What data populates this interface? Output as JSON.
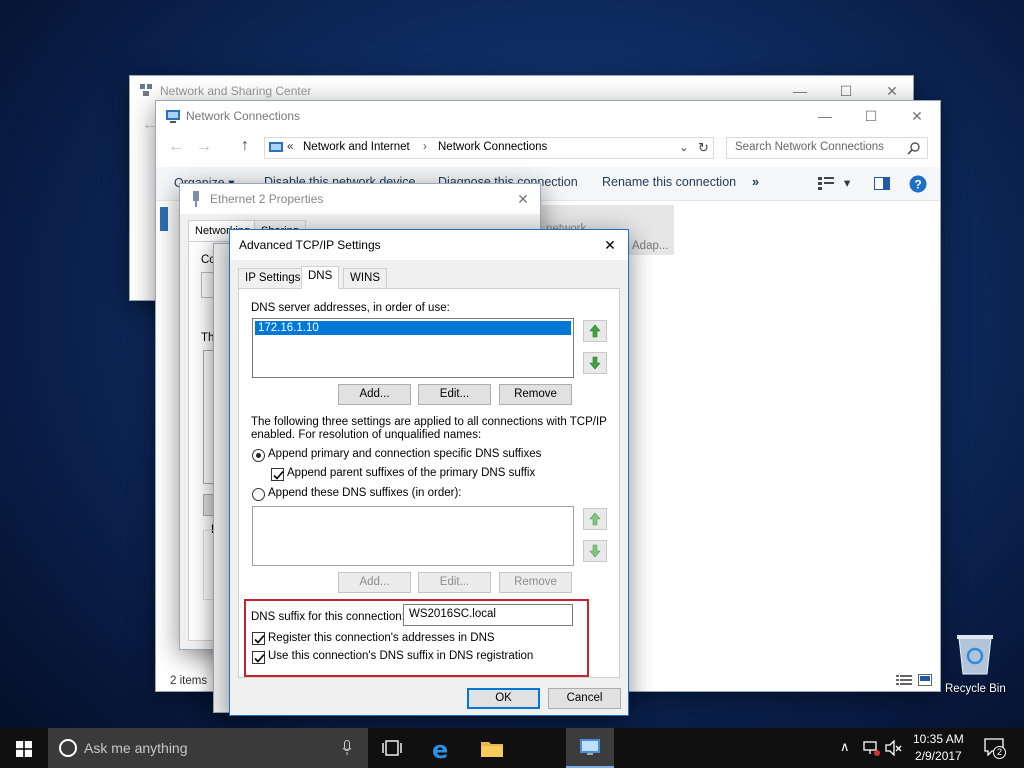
{
  "network_sharing_center": {
    "title": "Network and Sharing Center"
  },
  "network_connections": {
    "title": "Network Connections",
    "breadcrumb": [
      "«",
      "Network and Internet",
      "Network Connections"
    ],
    "search_placeholder": "Search Network Connections",
    "commands": {
      "organize": "Organize ▾",
      "disable": "Disable this network device",
      "diagnose": "Diagnose this connection",
      "rename": "Rename this connection",
      "more": "»"
    },
    "item_partial_1": "network",
    "item_partial_2": "Adap...",
    "status": "2 items"
  },
  "ethernet_properties": {
    "title": "Ethernet 2 Properties",
    "tabs": [
      "Networking",
      "Sharing"
    ],
    "label_partial_1": "Co",
    "label_partial_2": "Th",
    "label_partial_3": "In",
    "label_partial_4": "D"
  },
  "advanced_tcpip": {
    "title": "Advanced TCP/IP Settings",
    "tabs": [
      "IP Settings",
      "DNS",
      "WINS"
    ],
    "dns_servers_label": "DNS server addresses, in order of use:",
    "dns_servers": [
      "172.16.1.10"
    ],
    "btn_add": "Add...",
    "btn_edit": "Edit...",
    "btn_remove": "Remove",
    "info_line_1": "The following three settings are applied to all connections with TCP/IP",
    "info_line_2": "enabled. For resolution of unqualified names:",
    "radio_append_primary": "Append primary and connection specific DNS suffixes",
    "check_append_parent": "Append parent suffixes of the primary DNS suffix",
    "radio_append_these": "Append these DNS suffixes (in order):",
    "dns_suffix_label": "DNS suffix for this connection:",
    "dns_suffix_value": "WS2016SC.local",
    "check_register": "Register this connection's addresses in DNS",
    "check_use_suffix": "Use this connection's DNS suffix in DNS registration",
    "btn_ok": "OK",
    "btn_cancel": "Cancel"
  },
  "desktop": {
    "recycle_bin": "Recycle Bin"
  },
  "taskbar": {
    "search_placeholder": "Ask me anything",
    "time": "10:35 AM",
    "date": "2/9/2017",
    "notification_count": "2"
  },
  "colors": {
    "accent": "#0078d7",
    "highlight_box": "#c8232c"
  }
}
